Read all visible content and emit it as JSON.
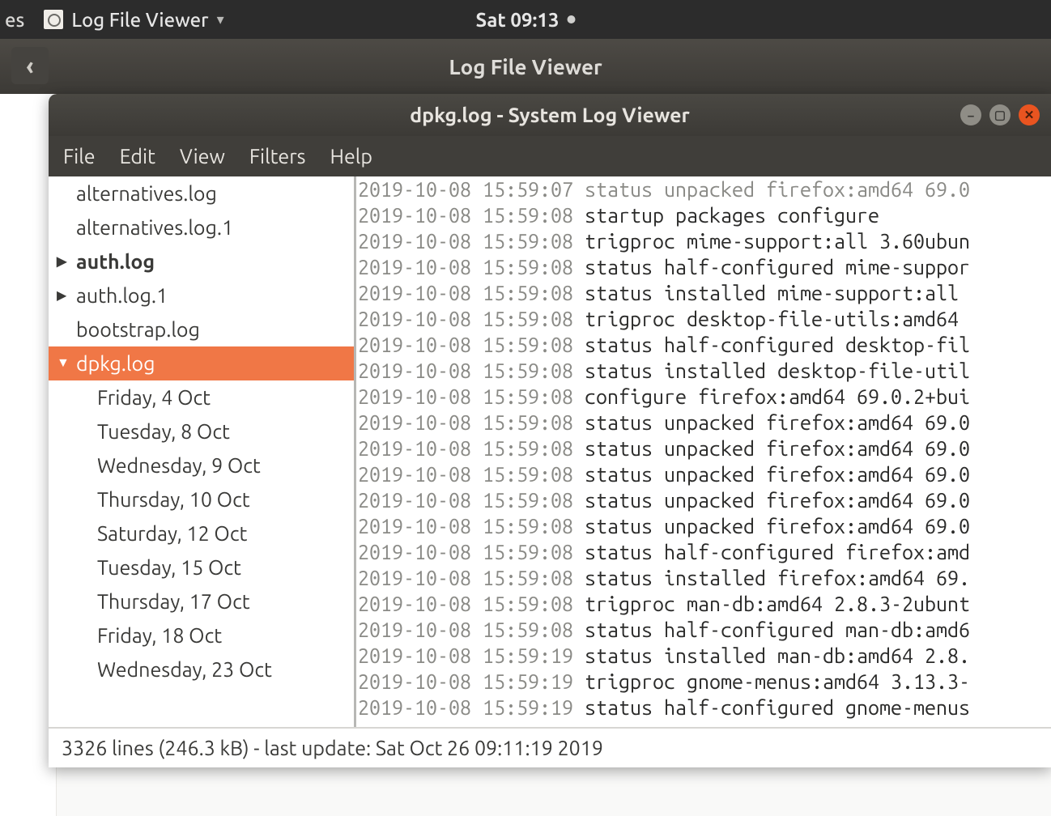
{
  "top_bar": {
    "left_fragment": "es",
    "app_name": "Log File Viewer",
    "clock": "Sat 09:13"
  },
  "secondary_bar": {
    "title": "Log File Viewer"
  },
  "window": {
    "title": "dpkg.log - System Log Viewer",
    "menu": [
      "File",
      "Edit",
      "View",
      "Filters",
      "Help"
    ]
  },
  "sidebar": {
    "items": [
      {
        "label": "alternatives.log",
        "caret": false,
        "bold": false,
        "selected": false
      },
      {
        "label": "alternatives.log.1",
        "caret": false,
        "bold": false,
        "selected": false
      },
      {
        "label": "auth.log",
        "caret": true,
        "bold": true,
        "selected": false,
        "expanded": false
      },
      {
        "label": "auth.log.1",
        "caret": true,
        "bold": false,
        "selected": false,
        "expanded": false
      },
      {
        "label": "bootstrap.log",
        "caret": false,
        "bold": false,
        "selected": false
      },
      {
        "label": "dpkg.log",
        "caret": true,
        "bold": false,
        "selected": true,
        "expanded": true
      }
    ],
    "children": [
      "Friday,  4 Oct",
      "Tuesday,  8 Oct",
      "Wednesday,  9 Oct",
      "Thursday, 10 Oct",
      "Saturday, 12 Oct",
      "Tuesday, 15 Oct",
      "Thursday, 17 Oct",
      "Friday, 18 Oct",
      "Wednesday, 23 Oct"
    ]
  },
  "log_lines": [
    {
      "ts": "2019-10-08 15:59:07",
      "msg": "status unpacked firefox:amd64 69.0",
      "cut": true
    },
    {
      "ts": "2019-10-08 15:59:08",
      "msg": "startup packages configure"
    },
    {
      "ts": "2019-10-08 15:59:08",
      "msg": "trigproc mime-support:all 3.60ubun"
    },
    {
      "ts": "2019-10-08 15:59:08",
      "msg": "status half-configured mime-suppor"
    },
    {
      "ts": "2019-10-08 15:59:08",
      "msg": "status installed mime-support:all "
    },
    {
      "ts": "2019-10-08 15:59:08",
      "msg": "trigproc desktop-file-utils:amd64 "
    },
    {
      "ts": "2019-10-08 15:59:08",
      "msg": "status half-configured desktop-fil"
    },
    {
      "ts": "2019-10-08 15:59:08",
      "msg": "status installed desktop-file-util"
    },
    {
      "ts": "2019-10-08 15:59:08",
      "msg": "configure firefox:amd64 69.0.2+bui"
    },
    {
      "ts": "2019-10-08 15:59:08",
      "msg": "status unpacked firefox:amd64 69.0"
    },
    {
      "ts": "2019-10-08 15:59:08",
      "msg": "status unpacked firefox:amd64 69.0"
    },
    {
      "ts": "2019-10-08 15:59:08",
      "msg": "status unpacked firefox:amd64 69.0"
    },
    {
      "ts": "2019-10-08 15:59:08",
      "msg": "status unpacked firefox:amd64 69.0"
    },
    {
      "ts": "2019-10-08 15:59:08",
      "msg": "status unpacked firefox:amd64 69.0"
    },
    {
      "ts": "2019-10-08 15:59:08",
      "msg": "status half-configured firefox:amd"
    },
    {
      "ts": "2019-10-08 15:59:08",
      "msg": "status installed firefox:amd64 69."
    },
    {
      "ts": "2019-10-08 15:59:08",
      "msg": "trigproc man-db:amd64 2.8.3-2ubunt"
    },
    {
      "ts": "2019-10-08 15:59:08",
      "msg": "status half-configured man-db:amd6"
    },
    {
      "ts": "2019-10-08 15:59:19",
      "msg": "status installed man-db:amd64 2.8."
    },
    {
      "ts": "2019-10-08 15:59:19",
      "msg": "trigproc gnome-menus:amd64 3.13.3-"
    },
    {
      "ts": "2019-10-08 15:59:19",
      "msg": "status half-configured gnome-menus"
    }
  ],
  "status_bar": "3326 lines (246.3 kB) - last update: Sat Oct 26 09:11:19 2019"
}
